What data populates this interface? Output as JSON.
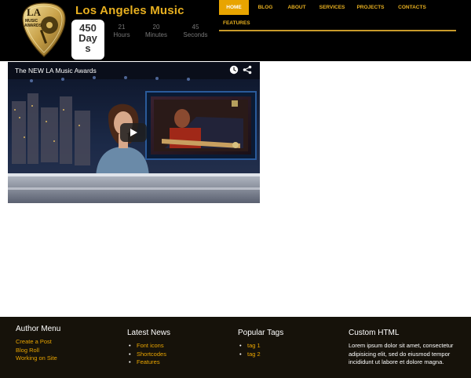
{
  "header": {
    "site_title": "Los Angeles Music",
    "logo_text": [
      "LA",
      "MUSIC",
      "AWARDS"
    ],
    "countdown": {
      "days_value": "450",
      "days_unit": "Day",
      "days_unit_tail": "s",
      "hours_value": "21",
      "hours_label": "Hours",
      "minutes_value": "20",
      "minutes_label": "Minutes",
      "seconds_value": "45",
      "seconds_label": "Seconds"
    }
  },
  "nav": {
    "items": [
      {
        "label": "HOME",
        "active": true
      },
      {
        "label": "BLOG"
      },
      {
        "label": "ABOUT"
      },
      {
        "label": "SERVICES"
      },
      {
        "label": "PROJECTS"
      },
      {
        "label": "CONTACTS"
      },
      {
        "label": "FEATURES"
      }
    ]
  },
  "video": {
    "title": "The NEW LA Music Awards",
    "icons": [
      "clock-icon",
      "share-icon",
      "play-icon"
    ]
  },
  "footer": {
    "author_menu": {
      "title": "Author Menu",
      "links": [
        "Create a Post",
        "Blog Roll",
        "Working on Site"
      ]
    },
    "latest_news": {
      "title": "Latest News",
      "links": [
        "Font icons",
        "Shortcodes",
        "Features"
      ]
    },
    "popular_tags": {
      "title": "Popular Tags",
      "links": [
        "tag 1",
        "tag 2"
      ]
    },
    "custom_html": {
      "title": "Custom HTML",
      "text": "Lorem ipsum dolor sit amet, consectetur adipisicing elit, sed do eiusmod tempor incididunt ut labore et dolore magna."
    }
  },
  "colors": {
    "accent": "#e8a400",
    "header_bg": "#000000",
    "footer_bg": "#16120a"
  }
}
